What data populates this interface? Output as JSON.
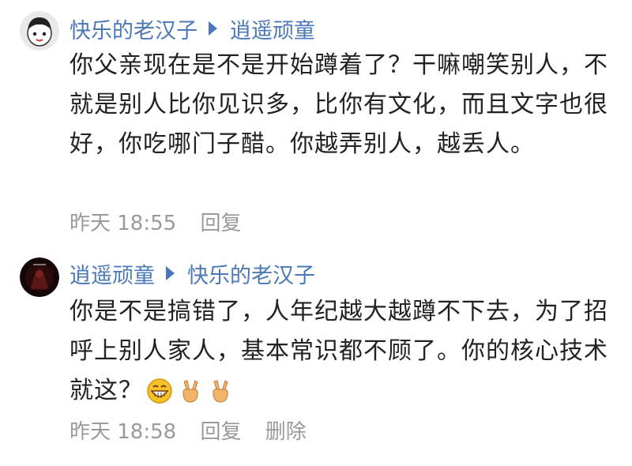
{
  "comments": [
    {
      "author": "快乐的老汉子",
      "reply_to": "逍遥顽童",
      "text": "你父亲现在是不是开始蹲着了？干嘛嘲笑别人，不就是别人比你见识多，比你有文化，而且文字也很好，你吃哪门子醋。你越弄别人，越丢人。",
      "time": "昨天 18:55",
      "reply_label": "回复"
    },
    {
      "author": "逍遥顽童",
      "reply_to": "快乐的老汉子",
      "text": "你是不是搞错了，人年纪越大越蹲不下去，为了招呼上别人家人，基本常识都不顾了。你的核心技术就这？",
      "emojis": [
        "grinning-emoji",
        "victory-hand-emoji",
        "victory-hand-emoji"
      ],
      "time": "昨天 18:58",
      "reply_label": "回复",
      "delete_label": "删除"
    }
  ],
  "colors": {
    "link": "#4a78b8",
    "text": "#222222",
    "meta": "#9a9a9a"
  }
}
